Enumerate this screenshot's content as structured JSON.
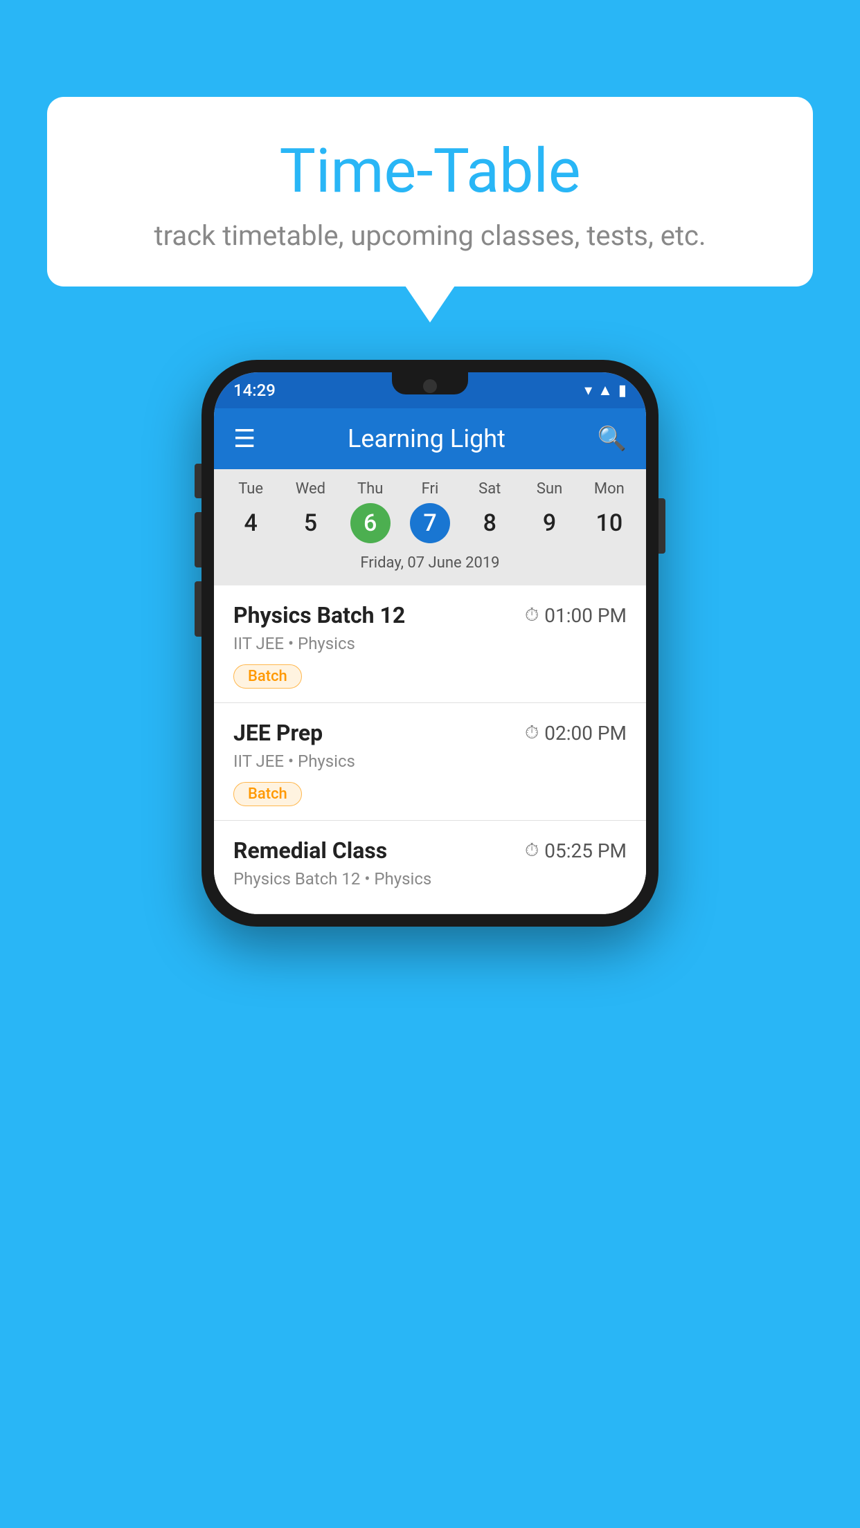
{
  "background_color": "#29B6F6",
  "bubble": {
    "title": "Time-Table",
    "subtitle": "track timetable, upcoming classes, tests, etc."
  },
  "phone": {
    "status_bar": {
      "time": "14:29"
    },
    "app_bar": {
      "title": "Learning Light"
    },
    "calendar": {
      "days": [
        {
          "name": "Tue",
          "num": "4",
          "state": "normal"
        },
        {
          "name": "Wed",
          "num": "5",
          "state": "normal"
        },
        {
          "name": "Thu",
          "num": "6",
          "state": "today"
        },
        {
          "name": "Fri",
          "num": "7",
          "state": "selected"
        },
        {
          "name": "Sat",
          "num": "8",
          "state": "normal"
        },
        {
          "name": "Sun",
          "num": "9",
          "state": "normal"
        },
        {
          "name": "Mon",
          "num": "10",
          "state": "normal"
        }
      ],
      "selected_date": "Friday, 07 June 2019"
    },
    "schedule_items": [
      {
        "name": "Physics Batch 12",
        "time": "01:00 PM",
        "meta": "IIT JEE • Physics",
        "tag": "Batch"
      },
      {
        "name": "JEE Prep",
        "time": "02:00 PM",
        "meta": "IIT JEE • Physics",
        "tag": "Batch"
      },
      {
        "name": "Remedial Class",
        "time": "05:25 PM",
        "meta": "Physics Batch 12 • Physics",
        "tag": ""
      }
    ]
  }
}
